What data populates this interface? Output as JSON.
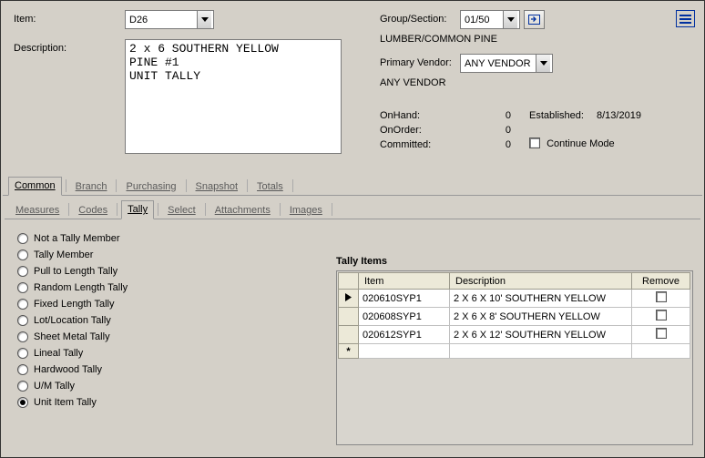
{
  "header": {
    "item_label": "Item:",
    "item_value": "D26",
    "description_label": "Description:",
    "description_value": "2 x 6 SOUTHERN YELLOW\nPINE #1\nUNIT TALLY",
    "group_label": "Group/Section:",
    "group_value": "01/50",
    "group_name": "LUMBER/COMMON PINE",
    "vendor_label": "Primary Vendor:",
    "vendor_value": "ANY VENDOR",
    "vendor_name": "ANY VENDOR",
    "onhand_label": "OnHand:",
    "onhand_value": "0",
    "onorder_label": "OnOrder:",
    "onorder_value": "0",
    "committed_label": "Committed:",
    "committed_value": "0",
    "established_label": "Established:",
    "established_value": "8/13/2019",
    "continue_label": "Continue Mode"
  },
  "tabs1": [
    "Common",
    "Branch",
    "Purchasing",
    "Snapshot",
    "Totals"
  ],
  "tabs1_active": 0,
  "tabs2": [
    "Measures",
    "Codes",
    "Tally",
    "Select",
    "Attachments",
    "Images"
  ],
  "tabs2_active": 2,
  "tally_types": [
    "Not a Tally Member",
    "Tally Member",
    "Pull to Length Tally",
    "Random Length Tally",
    "Fixed Length Tally",
    "Lot/Location Tally",
    "Sheet Metal Tally",
    "Lineal Tally",
    "Hardwood Tally",
    "U/M Tally",
    "Unit Item Tally"
  ],
  "tally_selected": 10,
  "grid": {
    "title": "Tally Items",
    "cols": [
      "Item",
      "Description",
      "Remove"
    ],
    "rows": [
      {
        "item": "020610SYP1",
        "desc": "2 X 6 X 10' SOUTHERN YELLOW"
      },
      {
        "item": "020608SYP1",
        "desc": "2 X 6 X 8' SOUTHERN YELLOW"
      },
      {
        "item": "020612SYP1",
        "desc": "2 X 6 X 12' SOUTHERN YELLOW"
      }
    ]
  }
}
